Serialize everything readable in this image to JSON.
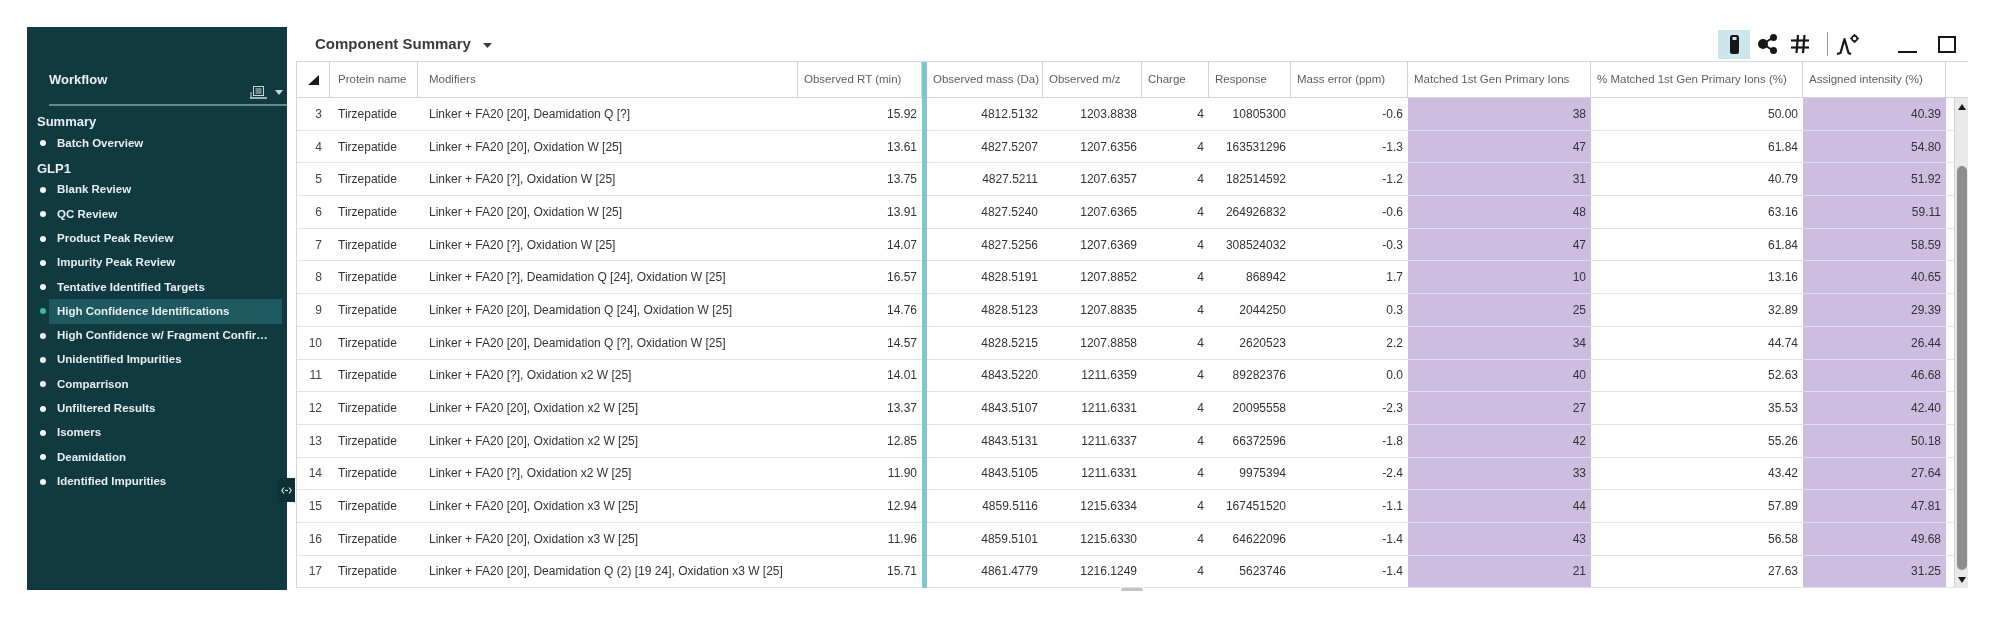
{
  "sidebar": {
    "title": "Workflow",
    "sections": [
      {
        "heading": "Summary",
        "items": [
          {
            "label": "Batch Overview",
            "selected": false
          }
        ]
      },
      {
        "heading": "GLP1",
        "items": [
          {
            "label": "Blank Review",
            "selected": false
          },
          {
            "label": "QC Review",
            "selected": false
          },
          {
            "label": "Product Peak Review",
            "selected": false
          },
          {
            "label": "Impurity Peak Review",
            "selected": false
          },
          {
            "label": "Tentative Identified Targets",
            "selected": false
          },
          {
            "label": "High Confidence Identifications",
            "selected": true
          },
          {
            "label": "High Confidence w/ Fragment Confir…",
            "selected": false
          },
          {
            "label": "Unidentified Impurities",
            "selected": false
          },
          {
            "label": "Comparrison",
            "selected": false
          },
          {
            "label": "Unfiltered Results",
            "selected": false
          },
          {
            "label": "Isomers",
            "selected": false
          },
          {
            "label": "Deamidation",
            "selected": false
          },
          {
            "label": "Identified Impurities",
            "selected": false
          }
        ]
      }
    ]
  },
  "panel": {
    "title": "Component Summary",
    "toolbar": [
      {
        "kind": "tube",
        "selected": true
      },
      {
        "kind": "nodes",
        "selected": false
      },
      {
        "kind": "hash",
        "selected": false
      },
      {
        "kind": "peak-settings",
        "selected": false
      }
    ],
    "window_controls": [
      {
        "kind": "minimize"
      },
      {
        "kind": "maximize"
      }
    ]
  },
  "table": {
    "columns": [
      {
        "label": "Protein name",
        "highlighted": false
      },
      {
        "label": "Modifiers",
        "highlighted": false
      },
      {
        "label": "Observed RT (min)",
        "highlighted": false
      },
      {
        "label": "Observed mass (Da)",
        "highlighted": false
      },
      {
        "label": "Observed m/z",
        "highlighted": false
      },
      {
        "label": "Charge",
        "highlighted": false
      },
      {
        "label": "Response",
        "highlighted": false
      },
      {
        "label": "Mass error (ppm)",
        "highlighted": false
      },
      {
        "label": "Matched 1st Gen Primary Ions",
        "highlighted": true
      },
      {
        "label": "% Matched 1st Gen Primary Ions (%)",
        "highlighted": false
      },
      {
        "label": "Assigned intensity (%)",
        "highlighted": true
      }
    ],
    "rows": [
      {
        "number": "3",
        "cells": [
          "Tirzepatide",
          "Linker + FA20 [20], Deamidation Q [?]",
          "15.92",
          "4812.5132",
          "1203.8838",
          "4",
          "10805300",
          "-0.6",
          "38",
          "50.00",
          "40.39"
        ]
      },
      {
        "number": "4",
        "cells": [
          "Tirzepatide",
          "Linker + FA20 [20], Oxidation W [25]",
          "13.61",
          "4827.5207",
          "1207.6356",
          "4",
          "163531296",
          "-1.3",
          "47",
          "61.84",
          "54.80"
        ]
      },
      {
        "number": "5",
        "cells": [
          "Tirzepatide",
          "Linker + FA20 [?], Oxidation W [25]",
          "13.75",
          "4827.5211",
          "1207.6357",
          "4",
          "182514592",
          "-1.2",
          "31",
          "40.79",
          "51.92"
        ]
      },
      {
        "number": "6",
        "cells": [
          "Tirzepatide",
          "Linker + FA20 [20], Oxidation W [25]",
          "13.91",
          "4827.5240",
          "1207.6365",
          "4",
          "264926832",
          "-0.6",
          "48",
          "63.16",
          "59.11"
        ]
      },
      {
        "number": "7",
        "cells": [
          "Tirzepatide",
          "Linker + FA20 [?], Oxidation W [25]",
          "14.07",
          "4827.5256",
          "1207.6369",
          "4",
          "308524032",
          "-0.3",
          "47",
          "61.84",
          "58.59"
        ]
      },
      {
        "number": "8",
        "cells": [
          "Tirzepatide",
          "Linker + FA20 [?], Deamidation Q [24], Oxidation W [25]",
          "16.57",
          "4828.5191",
          "1207.8852",
          "4",
          "868942",
          "1.7",
          "10",
          "13.16",
          "40.65"
        ]
      },
      {
        "number": "9",
        "cells": [
          "Tirzepatide",
          "Linker + FA20 [20], Deamidation Q [24], Oxidation W [25]",
          "14.76",
          "4828.5123",
          "1207.8835",
          "4",
          "2044250",
          "0.3",
          "25",
          "32.89",
          "29.39"
        ]
      },
      {
        "number": "10",
        "cells": [
          "Tirzepatide",
          "Linker + FA20 [20], Deamidation Q [?], Oxidation W [25]",
          "14.57",
          "4828.5215",
          "1207.8858",
          "4",
          "2620523",
          "2.2",
          "34",
          "44.74",
          "26.44"
        ]
      },
      {
        "number": "11",
        "cells": [
          "Tirzepatide",
          "Linker + FA20 [?], Oxidation x2 W [25]",
          "14.01",
          "4843.5220",
          "1211.6359",
          "4",
          "89282376",
          "0.0",
          "40",
          "52.63",
          "46.68"
        ]
      },
      {
        "number": "12",
        "cells": [
          "Tirzepatide",
          "Linker + FA20 [20], Oxidation x2 W [25]",
          "13.37",
          "4843.5107",
          "1211.6331",
          "4",
          "20095558",
          "-2.3",
          "27",
          "35.53",
          "42.40"
        ]
      },
      {
        "number": "13",
        "cells": [
          "Tirzepatide",
          "Linker + FA20 [20], Oxidation x2 W [25]",
          "12.85",
          "4843.5131",
          "1211.6337",
          "4",
          "66372596",
          "-1.8",
          "42",
          "55.26",
          "50.18"
        ]
      },
      {
        "number": "14",
        "cells": [
          "Tirzepatide",
          "Linker + FA20 [?], Oxidation x2 W [25]",
          "11.90",
          "4843.5105",
          "1211.6331",
          "4",
          "9975394",
          "-2.4",
          "33",
          "43.42",
          "27.64"
        ]
      },
      {
        "number": "15",
        "cells": [
          "Tirzepatide",
          "Linker + FA20 [20], Oxidation x3 W [25]",
          "12.94",
          "4859.5116",
          "1215.6334",
          "4",
          "167451520",
          "-1.1",
          "44",
          "57.89",
          "47.81"
        ]
      },
      {
        "number": "16",
        "cells": [
          "Tirzepatide",
          "Linker + FA20 [20], Oxidation x3 W [25]",
          "11.96",
          "4859.5101",
          "1215.6330",
          "4",
          "64622096",
          "-1.4",
          "43",
          "56.58",
          "49.68"
        ]
      },
      {
        "number": "17",
        "cells": [
          "Tirzepatide",
          "Linker + FA20 [20], Deamidation Q (2) [19 24], Oxidation x3 W [25]",
          "15.71",
          "4861.4779",
          "1216.1249",
          "4",
          "5623746",
          "-1.4",
          "21",
          "27.63",
          "31.25"
        ]
      }
    ]
  }
}
